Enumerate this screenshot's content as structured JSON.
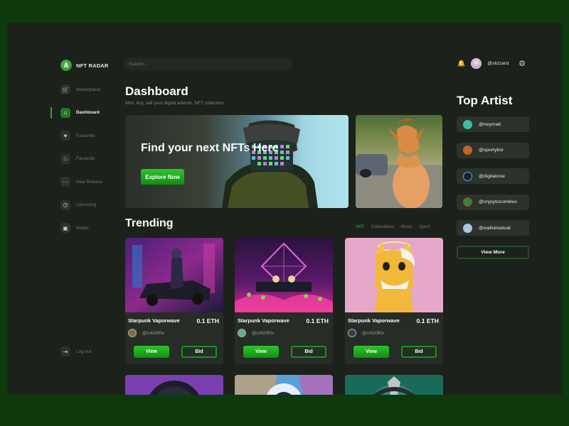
{
  "brand": {
    "name": "NFT RADAR",
    "logo_icon": "logo-icon"
  },
  "sidebar": {
    "items": [
      {
        "label": "Marketplace",
        "icon": "cart-icon",
        "active": false
      },
      {
        "label": "Dashboard",
        "icon": "home-icon",
        "active": true
      },
      {
        "label": "Favourite",
        "icon": "heart-icon",
        "active": false
      },
      {
        "label": "Favourite",
        "icon": "fire-icon",
        "active": false
      },
      {
        "label": "New Release",
        "icon": "dots-icon",
        "active": false
      },
      {
        "label": "Upcoming",
        "icon": "clock-icon",
        "active": false
      },
      {
        "label": "Wallet",
        "icon": "wallet-icon",
        "active": false
      }
    ],
    "logout_label": "Log out"
  },
  "header": {
    "search_placeholder": "Search...",
    "username": "@slizzard"
  },
  "main": {
    "title": "Dashboard",
    "subtitle": "Mint, buy, sell your digital artwork, NFT collection",
    "hero": {
      "title": "Find your next NFTs Here",
      "button_label": "Explore Now"
    },
    "trending": {
      "title": "Trending",
      "tabs": [
        "ART",
        "Collectibles",
        "Music",
        "Sport"
      ],
      "active_tab": "ART",
      "cards": [
        {
          "name": "Starpunk Vaporwave",
          "price": "0.1 ETH",
          "creator": "@cr4zl3f0x",
          "view_label": "View",
          "bid_label": "Bid"
        },
        {
          "name": "Starpunk Vaporwave",
          "price": "0.1 ETH",
          "creator": "@cr4zl3f0x",
          "view_label": "View",
          "bid_label": "Bid"
        },
        {
          "name": "Starpunk Vaporwave",
          "price": "0.1 ETH",
          "creator": "@cr4zl3f0x",
          "view_label": "View",
          "bid_label": "Bid"
        }
      ]
    }
  },
  "top_artists": {
    "title": "Top Artist",
    "artists": [
      "@neymatt",
      "@sportyboi",
      "@digitalcow",
      "@crypytozombies",
      "@wallstreetcat"
    ],
    "view_more_label": "View More"
  },
  "colors": {
    "accent": "#2fb82f",
    "background": "#1c211c",
    "outer": "#0c3a0c"
  }
}
